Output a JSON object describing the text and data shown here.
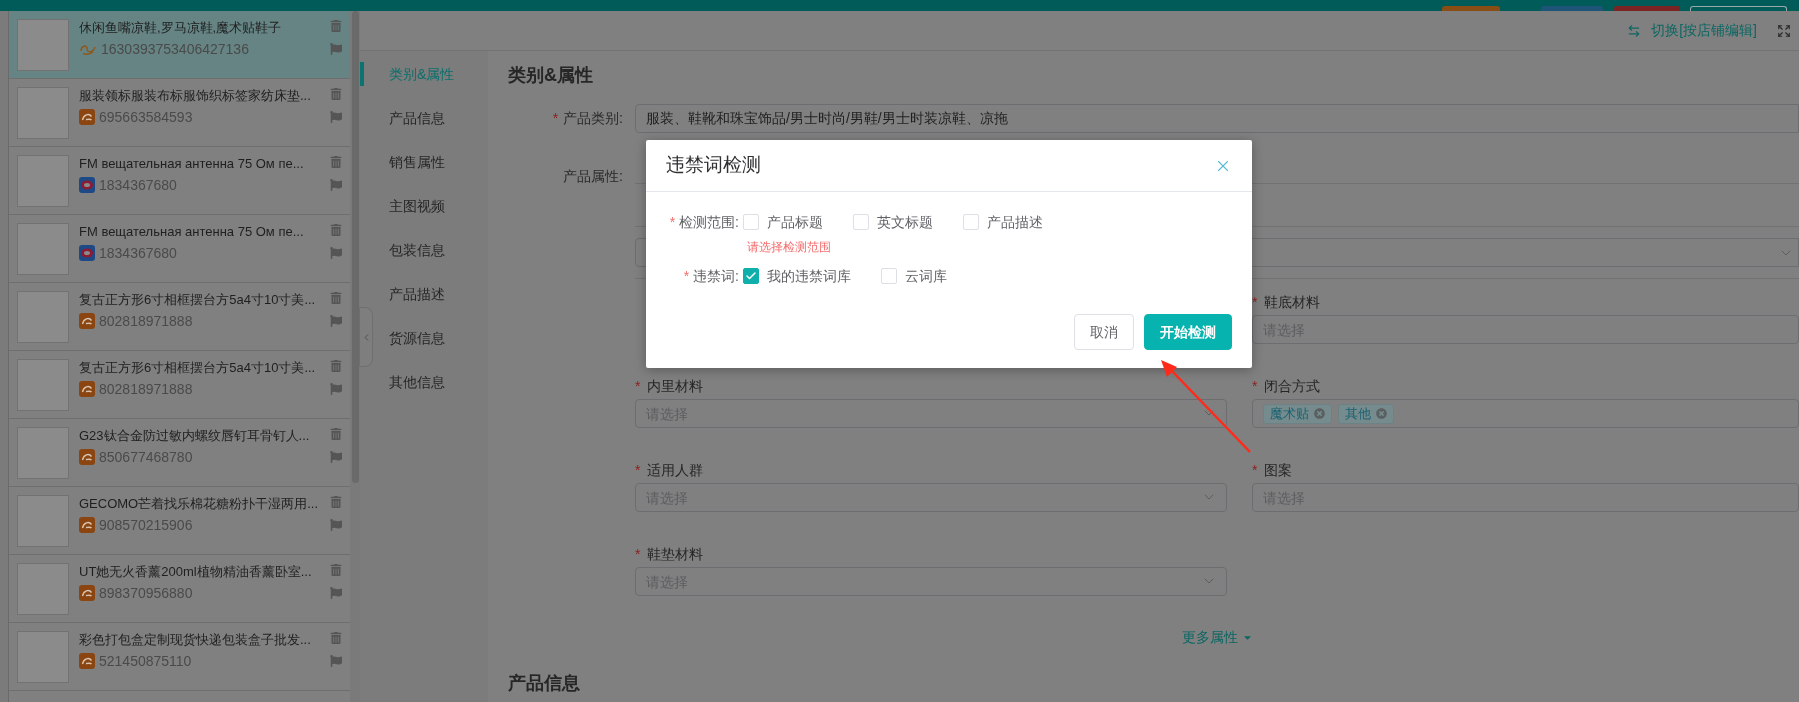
{
  "header": {
    "switch_link": "切换[按店铺编辑]"
  },
  "product_list": {
    "items": [
      {
        "title": "休闲鱼嘴凉鞋,罗马凉鞋,魔术贴鞋子",
        "id": "1630393753406427136",
        "kind": "swirl",
        "selected": true
      },
      {
        "title": "服装领标服装布标服饰织标签家纺床垫...",
        "id": "695663584593",
        "kind": "square",
        "selected": false
      },
      {
        "title": "FM вещательная антенна 75 Ом пе...",
        "id": "1834367680",
        "kind": "round",
        "selected": false
      },
      {
        "title": "FM вещательная антенна 75 Ом пе...",
        "id": "1834367680",
        "kind": "round",
        "selected": false
      },
      {
        "title": "复古正方形6寸相框摆台方5a4寸10寸美...",
        "id": "802818971888",
        "kind": "square",
        "selected": false
      },
      {
        "title": "复古正方形6寸相框摆台方5a4寸10寸美...",
        "id": "802818971888",
        "kind": "square",
        "selected": false
      },
      {
        "title": "G23钛合金防过敏内螺纹唇钉耳骨钉人...",
        "id": "850677468780",
        "kind": "square",
        "selected": false
      },
      {
        "title": "GECOMO芒着找乐棉花糖粉扑干湿两用...",
        "id": "908570215906",
        "kind": "square",
        "selected": false
      },
      {
        "title": "UT她无火香薰200ml植物精油香薰卧室...",
        "id": "898370956880",
        "kind": "square",
        "selected": false
      },
      {
        "title": "彩色打包盒定制现货快递包装盒子批发...",
        "id": "521450875110",
        "kind": "square",
        "selected": false
      }
    ]
  },
  "side_nav": {
    "items": [
      {
        "label": "类别&属性",
        "selected": true
      },
      {
        "label": "产品信息",
        "selected": false
      },
      {
        "label": "销售属性",
        "selected": false
      },
      {
        "label": "主图视频",
        "selected": false
      },
      {
        "label": "包装信息",
        "selected": false
      },
      {
        "label": "产品描述",
        "selected": false
      },
      {
        "label": "货源信息",
        "selected": false
      },
      {
        "label": "其他信息",
        "selected": false
      }
    ]
  },
  "form": {
    "section_title": "类别&属性",
    "category": {
      "mark": "*",
      "label": "产品类别:",
      "value": "服装、鞋靴和珠宝饰品/男士时尚/男鞋/男士时装凉鞋、凉拖"
    },
    "attributes": {
      "label": "产品属性:",
      "left_fields": [
        {
          "mark": "*",
          "label": "内里材料",
          "kind": "select",
          "placeholder": "请选择"
        },
        {
          "mark": "*",
          "label": "适用人群",
          "kind": "select",
          "placeholder": "请选择"
        },
        {
          "mark": "*",
          "label": "鞋垫材料",
          "kind": "select",
          "placeholder": "请选择"
        }
      ],
      "right_fields": [
        {
          "mark": "*",
          "label": "鞋底材料",
          "kind": "input",
          "placeholder": "请选择"
        },
        {
          "mark": "*",
          "label": "闭合方式",
          "kind": "tags",
          "tags": [
            "魔术贴",
            "其他"
          ]
        },
        {
          "mark": "*",
          "label": "图案",
          "kind": "input",
          "placeholder": "请选择"
        }
      ]
    },
    "more_link": "更多属性",
    "next_section_title": "产品信息"
  },
  "dialog": {
    "title": "违禁词检测",
    "rows": [
      {
        "mark": "*",
        "label": "检测范围:",
        "options": [
          {
            "label": "产品标题",
            "checked": false
          },
          {
            "label": "英文标题",
            "checked": false
          },
          {
            "label": "产品描述",
            "checked": false
          }
        ],
        "error": "请选择检测范围"
      },
      {
        "mark": "*",
        "label": "违禁词:",
        "options": [
          {
            "label": "我的违禁词库",
            "checked": true
          },
          {
            "label": "云词库",
            "checked": false
          }
        ]
      }
    ],
    "buttons": [
      {
        "label": "取消",
        "kind": "secondary"
      },
      {
        "label": "开始检测",
        "kind": "primary"
      }
    ]
  }
}
